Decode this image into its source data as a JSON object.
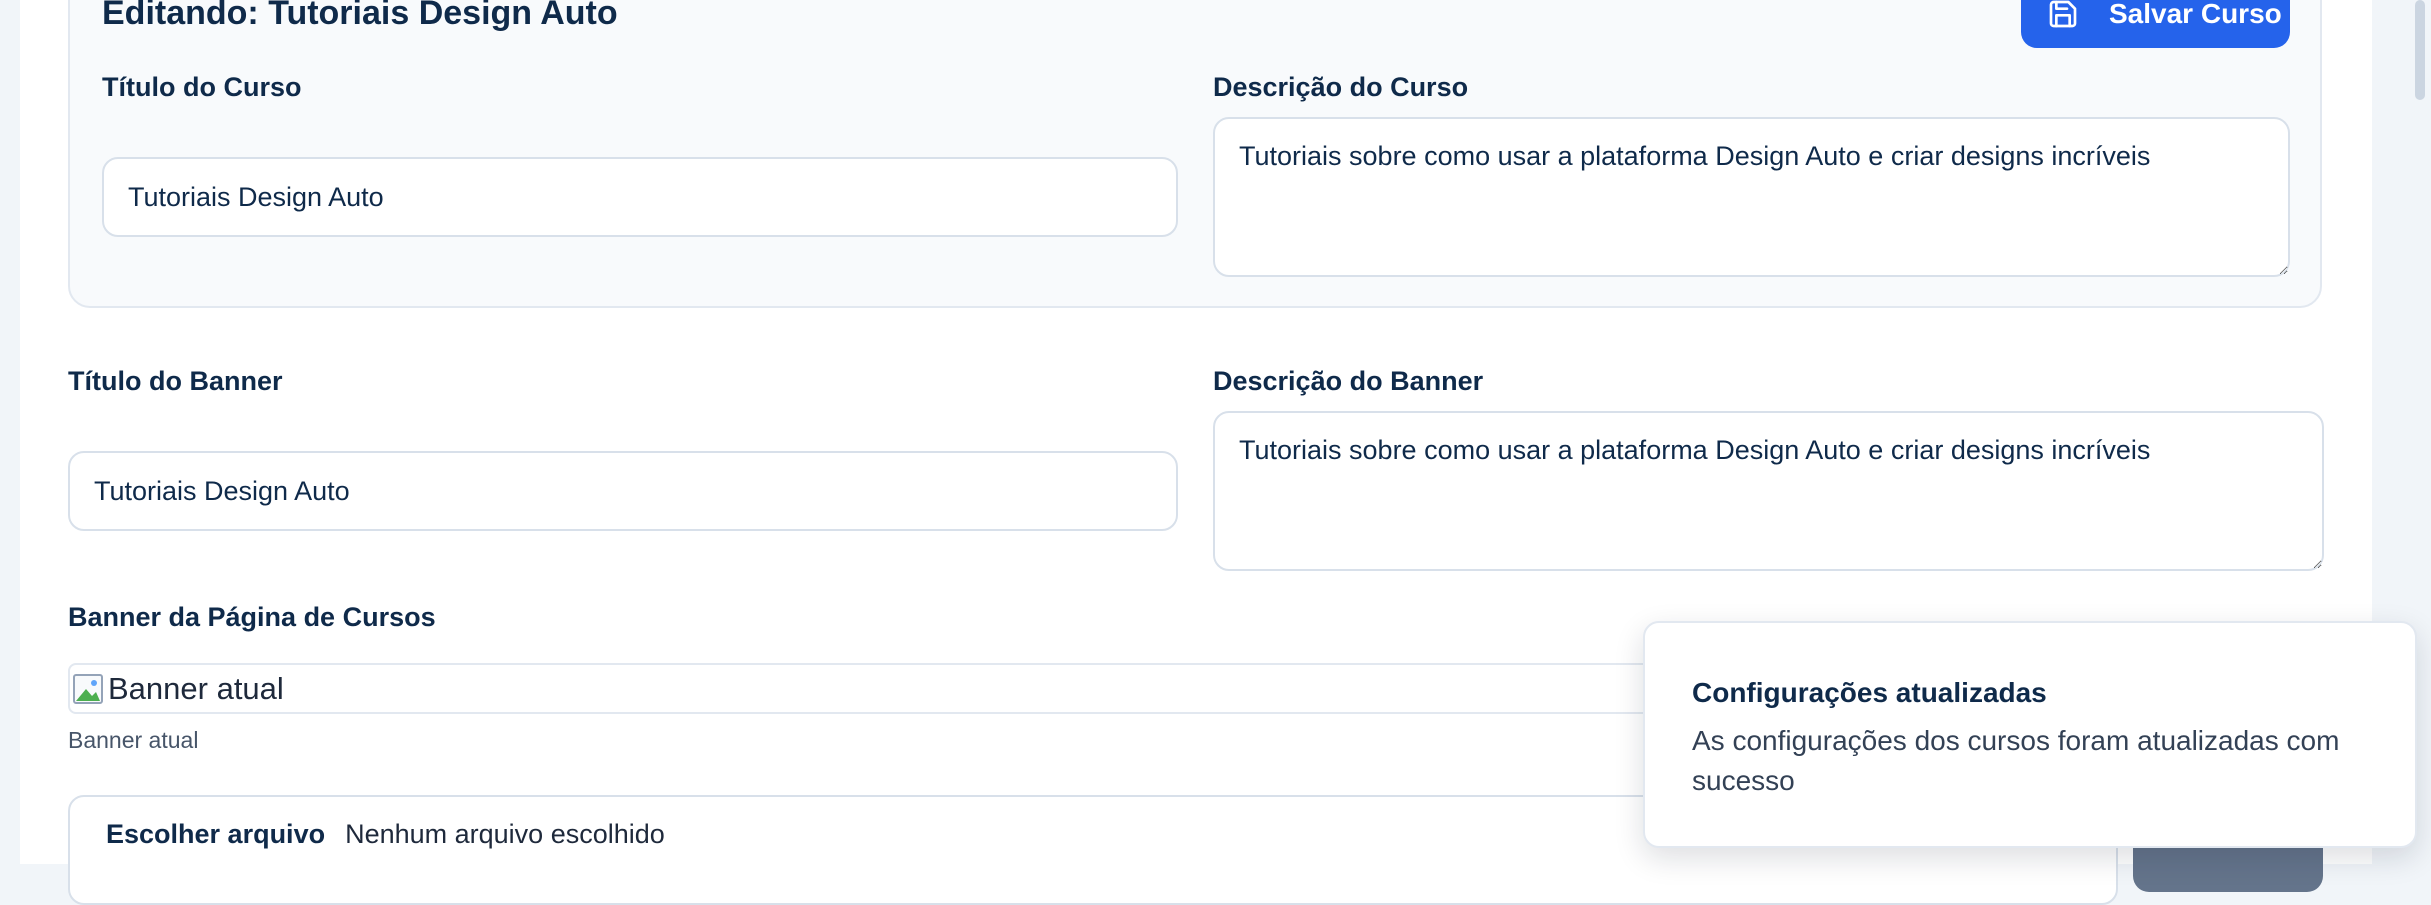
{
  "course_editor": {
    "heading": "Editando: Tutoriais Design Auto",
    "save_button": {
      "label": "Salvar Curso",
      "icon": "save-icon",
      "color": "#2563eb"
    },
    "title_field": {
      "label": "Título do Curso",
      "value": "Tutoriais Design Auto"
    },
    "description_field": {
      "label": "Descrição do Curso",
      "value": "Tutoriais sobre como usar a plataforma Design Auto e criar designs incríveis"
    }
  },
  "banner": {
    "title_field": {
      "label": "Título do Banner",
      "value": "Tutoriais Design Auto"
    },
    "description_field": {
      "label": "Descrição do Banner",
      "value": "Tutoriais sobre como usar a plataforma Design Auto e criar designs incríveis"
    },
    "section_label": "Banner da Página de Cursos",
    "current_image_alt": "Banner atual",
    "current_image_caption": "Banner atual",
    "file_picker": {
      "button_label": "Escolher arquivo",
      "status": "Nenhum arquivo escolhido"
    }
  },
  "toast": {
    "title": "Configurações atualizadas",
    "message": "As configurações dos cursos foram atualizadas com sucesso"
  }
}
